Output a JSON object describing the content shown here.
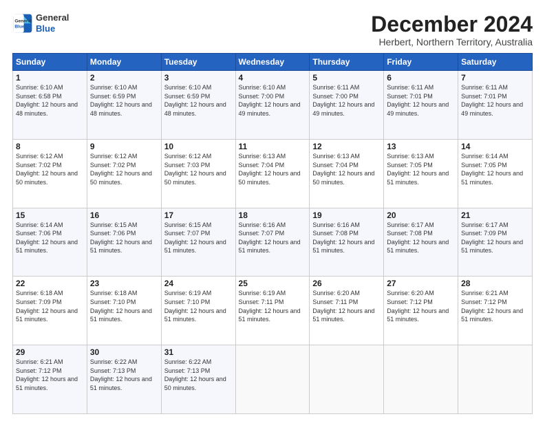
{
  "header": {
    "logo_line1": "General",
    "logo_line2": "Blue",
    "title": "December 2024",
    "subtitle": "Herbert, Northern Territory, Australia"
  },
  "weekdays": [
    "Sunday",
    "Monday",
    "Tuesday",
    "Wednesday",
    "Thursday",
    "Friday",
    "Saturday"
  ],
  "weeks": [
    [
      {
        "day": "1",
        "sunrise": "6:10 AM",
        "sunset": "6:58 PM",
        "daylight": "12 hours and 48 minutes."
      },
      {
        "day": "2",
        "sunrise": "6:10 AM",
        "sunset": "6:59 PM",
        "daylight": "12 hours and 48 minutes."
      },
      {
        "day": "3",
        "sunrise": "6:10 AM",
        "sunset": "6:59 PM",
        "daylight": "12 hours and 48 minutes."
      },
      {
        "day": "4",
        "sunrise": "6:10 AM",
        "sunset": "7:00 PM",
        "daylight": "12 hours and 49 minutes."
      },
      {
        "day": "5",
        "sunrise": "6:11 AM",
        "sunset": "7:00 PM",
        "daylight": "12 hours and 49 minutes."
      },
      {
        "day": "6",
        "sunrise": "6:11 AM",
        "sunset": "7:01 PM",
        "daylight": "12 hours and 49 minutes."
      },
      {
        "day": "7",
        "sunrise": "6:11 AM",
        "sunset": "7:01 PM",
        "daylight": "12 hours and 49 minutes."
      }
    ],
    [
      {
        "day": "8",
        "sunrise": "6:12 AM",
        "sunset": "7:02 PM",
        "daylight": "12 hours and 50 minutes."
      },
      {
        "day": "9",
        "sunrise": "6:12 AM",
        "sunset": "7:02 PM",
        "daylight": "12 hours and 50 minutes."
      },
      {
        "day": "10",
        "sunrise": "6:12 AM",
        "sunset": "7:03 PM",
        "daylight": "12 hours and 50 minutes."
      },
      {
        "day": "11",
        "sunrise": "6:13 AM",
        "sunset": "7:04 PM",
        "daylight": "12 hours and 50 minutes."
      },
      {
        "day": "12",
        "sunrise": "6:13 AM",
        "sunset": "7:04 PM",
        "daylight": "12 hours and 50 minutes."
      },
      {
        "day": "13",
        "sunrise": "6:13 AM",
        "sunset": "7:05 PM",
        "daylight": "12 hours and 51 minutes."
      },
      {
        "day": "14",
        "sunrise": "6:14 AM",
        "sunset": "7:05 PM",
        "daylight": "12 hours and 51 minutes."
      }
    ],
    [
      {
        "day": "15",
        "sunrise": "6:14 AM",
        "sunset": "7:06 PM",
        "daylight": "12 hours and 51 minutes."
      },
      {
        "day": "16",
        "sunrise": "6:15 AM",
        "sunset": "7:06 PM",
        "daylight": "12 hours and 51 minutes."
      },
      {
        "day": "17",
        "sunrise": "6:15 AM",
        "sunset": "7:07 PM",
        "daylight": "12 hours and 51 minutes."
      },
      {
        "day": "18",
        "sunrise": "6:16 AM",
        "sunset": "7:07 PM",
        "daylight": "12 hours and 51 minutes."
      },
      {
        "day": "19",
        "sunrise": "6:16 AM",
        "sunset": "7:08 PM",
        "daylight": "12 hours and 51 minutes."
      },
      {
        "day": "20",
        "sunrise": "6:17 AM",
        "sunset": "7:08 PM",
        "daylight": "12 hours and 51 minutes."
      },
      {
        "day": "21",
        "sunrise": "6:17 AM",
        "sunset": "7:09 PM",
        "daylight": "12 hours and 51 minutes."
      }
    ],
    [
      {
        "day": "22",
        "sunrise": "6:18 AM",
        "sunset": "7:09 PM",
        "daylight": "12 hours and 51 minutes."
      },
      {
        "day": "23",
        "sunrise": "6:18 AM",
        "sunset": "7:10 PM",
        "daylight": "12 hours and 51 minutes."
      },
      {
        "day": "24",
        "sunrise": "6:19 AM",
        "sunset": "7:10 PM",
        "daylight": "12 hours and 51 minutes."
      },
      {
        "day": "25",
        "sunrise": "6:19 AM",
        "sunset": "7:11 PM",
        "daylight": "12 hours and 51 minutes."
      },
      {
        "day": "26",
        "sunrise": "6:20 AM",
        "sunset": "7:11 PM",
        "daylight": "12 hours and 51 minutes."
      },
      {
        "day": "27",
        "sunrise": "6:20 AM",
        "sunset": "7:12 PM",
        "daylight": "12 hours and 51 minutes."
      },
      {
        "day": "28",
        "sunrise": "6:21 AM",
        "sunset": "7:12 PM",
        "daylight": "12 hours and 51 minutes."
      }
    ],
    [
      {
        "day": "29",
        "sunrise": "6:21 AM",
        "sunset": "7:12 PM",
        "daylight": "12 hours and 51 minutes."
      },
      {
        "day": "30",
        "sunrise": "6:22 AM",
        "sunset": "7:13 PM",
        "daylight": "12 hours and 51 minutes."
      },
      {
        "day": "31",
        "sunrise": "6:22 AM",
        "sunset": "7:13 PM",
        "daylight": "12 hours and 50 minutes."
      },
      null,
      null,
      null,
      null
    ]
  ]
}
